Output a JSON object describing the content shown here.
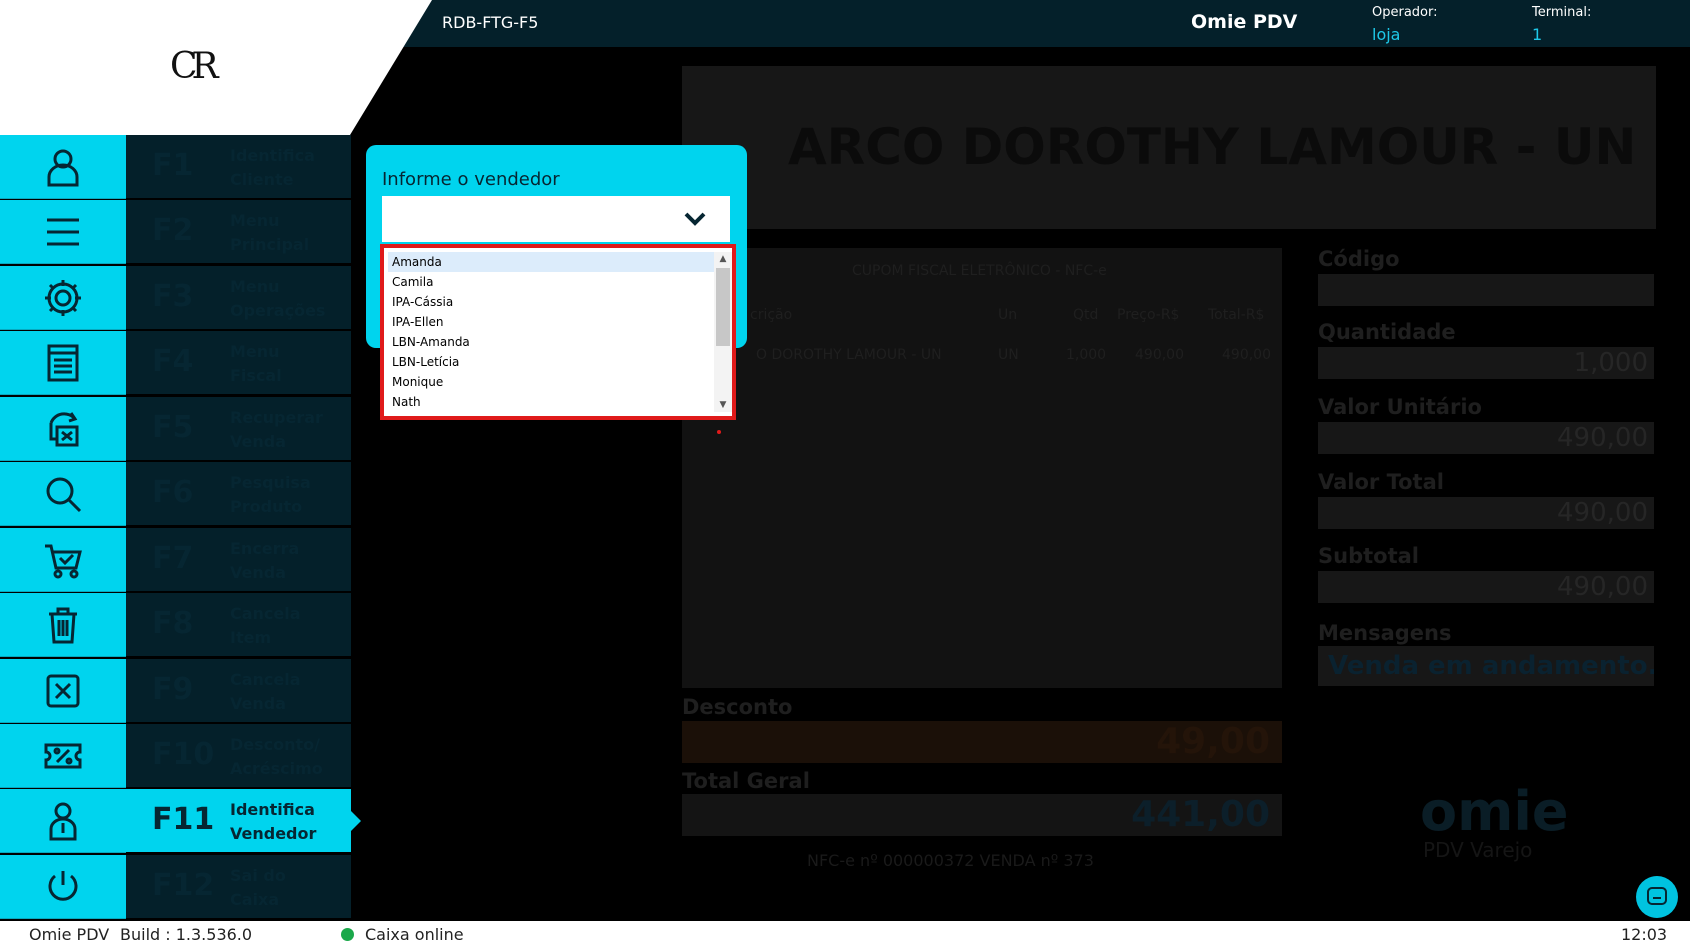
{
  "header": {
    "store_code": "RDB-FTG-F5",
    "app_name": "Omie PDV",
    "operator_label": "Operador:",
    "operator_value": "loja",
    "terminal_label": "Terminal:",
    "terminal_value": "1",
    "logo_text": "CR"
  },
  "sidebar": {
    "items": [
      {
        "code": "F1",
        "label": "Identifica\nCliente",
        "icon": "user-icon"
      },
      {
        "code": "F2",
        "label": "Menu\nPrincipal",
        "icon": "menu-icon"
      },
      {
        "code": "F3",
        "label": "Menu\nOperações",
        "icon": "gear-icon"
      },
      {
        "code": "F4",
        "label": "Menu\nFiscal",
        "icon": "receipt-icon"
      },
      {
        "code": "F5",
        "label": "Recuperar\nVenda",
        "icon": "recover-icon"
      },
      {
        "code": "F6",
        "label": "Pesquisa\nProduto",
        "icon": "search-icon"
      },
      {
        "code": "F7",
        "label": "Encerra\nVenda",
        "icon": "cart-check-icon"
      },
      {
        "code": "F8",
        "label": "Cancela\nItem",
        "icon": "trash-icon"
      },
      {
        "code": "F9",
        "label": "Cancela\nVenda",
        "icon": "cancel-box-icon"
      },
      {
        "code": "F10",
        "label": "Desconto/\nAcréscimo",
        "icon": "percent-ticket-icon"
      },
      {
        "code": "F11",
        "label": "Identifica\nVendedor",
        "icon": "seller-icon",
        "active": true
      },
      {
        "code": "F12",
        "label": "Sai do\nCaixa",
        "icon": "power-icon"
      }
    ]
  },
  "product": {
    "title": "ARCO DOROTHY LAMOUR - UN"
  },
  "receipt": {
    "heading": "CUPOM FISCAL ELETRÔNICO - NFC-e",
    "columns": [
      "crição",
      "Un",
      "Qtd",
      "Preço-R$",
      "Total-R$"
    ],
    "rows": [
      [
        "O DOROTHY LAMOUR - UN",
        "UN",
        "1,000",
        "490,00",
        "490,00"
      ]
    ]
  },
  "fields": {
    "codigo_label": "Código",
    "quantidade_label": "Quantidade",
    "quantidade_value": "1,000",
    "valor_unitario_label": "Valor Unitário",
    "valor_unitario_value": "490,00",
    "valor_total_label": "Valor Total",
    "valor_total_value": "490,00",
    "subtotal_label": "Subtotal",
    "subtotal_value": "490,00",
    "mensagens_label": "Mensagens",
    "mensagens_value": "Venda em andamento...",
    "desconto_label": "Desconto",
    "desconto_value": "49,00",
    "total_geral_label": "Total Geral",
    "total_geral_value": "441,00",
    "nfce_info": "NFC-e nº 000000372   VENDA nº 373"
  },
  "brand": {
    "name": "omie",
    "sub": "PDV Varejo"
  },
  "modal": {
    "label": "Informe o vendedor",
    "options": [
      "Amanda",
      "Camila",
      "IPA-Cássia",
      "IPA-Ellen",
      "LBN-Amanda",
      "LBN-Letícia",
      "Monique",
      "Nath"
    ],
    "highlighted": "Amanda"
  },
  "status": {
    "app": "Omie PDV",
    "build": "Build : 1.3.536.0",
    "caixa": "Caixa online",
    "time": "12:03",
    "online_color": "#1aa84a"
  }
}
